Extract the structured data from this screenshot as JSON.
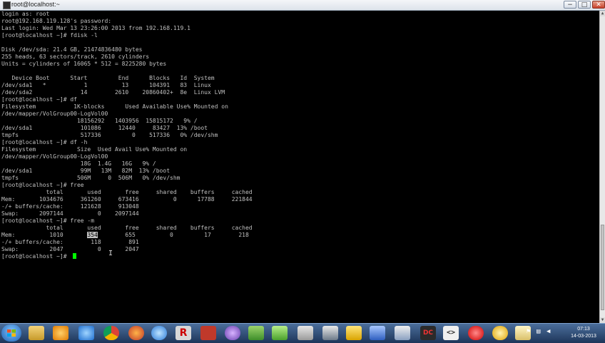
{
  "window": {
    "title": "root@localhost:~",
    "minimize": "−",
    "maximize": "□",
    "close": "✕"
  },
  "terminal": {
    "lines": [
      "login as: root",
      "root@192.168.119.128's password:",
      "Last login: Wed Mar 13 23:26:00 2013 from 192.168.119.1",
      "[root@localhost ~]# fdisk -l",
      "",
      "Disk /dev/sda: 21.4 GB, 21474836480 bytes",
      "255 heads, 63 sectors/track, 2610 cylinders",
      "Units = cylinders of 16065 * 512 = 8225280 bytes",
      "",
      "   Device Boot      Start         End      Blocks   Id  System",
      "/dev/sda1   *           1          13      104391   83  Linux",
      "/dev/sda2              14        2610    20860402+  8e  Linux LVM",
      "[root@localhost ~]# df",
      "Filesystem           1K-blocks      Used Available Use% Mounted on",
      "/dev/mapper/VolGroup00-LogVol00",
      "                      18156292   1403956  15815172   9% /",
      "/dev/sda1              101086     12440     83427  13% /boot",
      "tmpfs                  517336         0    517336   0% /dev/shm",
      "[root@localhost ~]# df -h",
      "Filesystem            Size  Used Avail Use% Mounted on",
      "/dev/mapper/VolGroup00-LogVol00",
      "                       18G  1.4G   16G   9% /",
      "/dev/sda1              99M   13M   82M  13% /boot",
      "tmpfs                 506M     0  506M   0% /dev/shm",
      "[root@localhost ~]# free",
      "             total       used       free     shared    buffers     cached",
      "Mem:       1034676     361260     673416          0      17788     221844",
      "-/+ buffers/cache:     121628     913048",
      "Swap:      2097144          0    2097144",
      "[root@localhost ~]# free -m",
      "             total       used       free     shared    buffers     cached",
      "Mem:          1010        ",
      "-/+ buffers/cache:        118        891",
      "Swap:         2047          0       2047",
      "[root@localhost ~]# "
    ],
    "highlight_prefix": "Mem:          1010       ",
    "highlight_value": "354",
    "highlight_suffix": "        655          0         17        218"
  },
  "taskbar": {
    "icons": [
      "windows-explorer-icon",
      "media-player-icon",
      "internet-explorer-icon",
      "chrome-icon",
      "firefox-icon",
      "refresh-icon",
      "r-app-icon",
      "archive-icon",
      "media-icon",
      "tools-icon",
      "notepad-plus-icon",
      "database-icon",
      "putty-icon",
      "paint-icon",
      "network-icon",
      "edit-icon",
      "dc-icon",
      "code-icon",
      "airtel-icon",
      "settings-icon",
      "notes-icon"
    ],
    "clock_time": "07:13",
    "clock_date": "14-03-2013"
  }
}
